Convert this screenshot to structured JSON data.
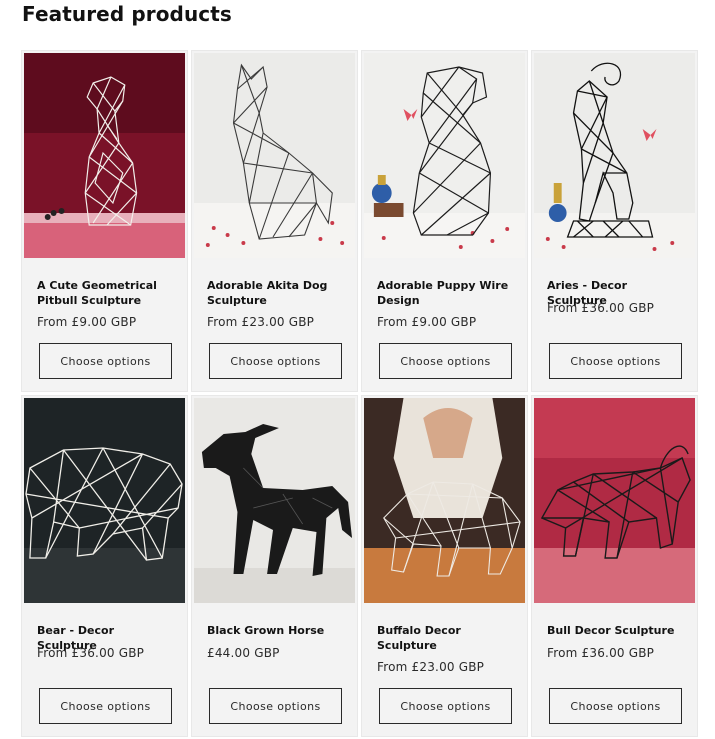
{
  "section": {
    "title": "Featured products"
  },
  "colors": {
    "card_background": "#f3f3f3",
    "button_border": "#2a2a2a",
    "text_primary": "#121212"
  },
  "products": [
    {
      "title": "A Cute Geometrical Pitbull Sculpture",
      "price": "From £9.00 GBP",
      "button": "Choose options",
      "image": "pitbull-white-wireframe-sculpture"
    },
    {
      "title": "Adorable Akita Dog Sculpture",
      "price": "From £23.00 GBP",
      "button": "Choose options",
      "image": "akita-dog-wireframe-sculpture"
    },
    {
      "title": "Adorable Puppy Wire Design",
      "price": "From £9.00 GBP",
      "button": "Choose options",
      "image": "puppy-wire-sculpture"
    },
    {
      "title": "Aries - Decor Sculpture",
      "price": "From £36.00 GBP",
      "button": "Choose options",
      "image": "ram-wireframe-sculpture"
    },
    {
      "title": "Bear - Decor Sculpture",
      "price": "From £36.00 GBP",
      "button": "Choose options",
      "image": "bear-white-wireframe-sculpture"
    },
    {
      "title": "Black Grown Horse",
      "price": "£44.00 GBP",
      "button": "Choose options",
      "image": "black-horse-sculpture"
    },
    {
      "title": "Buffalo Decor Sculpture",
      "price": "From £23.00 GBP",
      "button": "Choose options",
      "image": "buffalo-wireframe-sculpture"
    },
    {
      "title": "Bull Decor Sculpture",
      "price": "From £36.00 GBP",
      "button": "Choose options",
      "image": "bull-wireframe-sculpture"
    }
  ]
}
